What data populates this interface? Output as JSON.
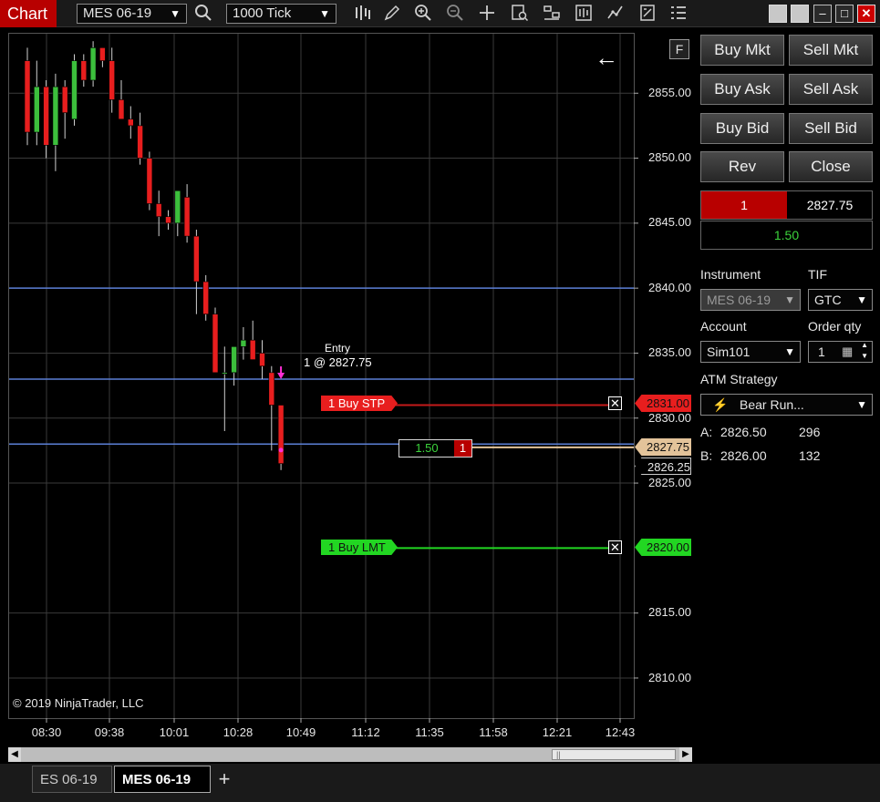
{
  "toolbar": {
    "title": "Chart",
    "instrument": "MES 06-19",
    "interval": "1000 Tick",
    "tools": [
      "bars-type-icon",
      "pencil-draw-icon",
      "zoom-in-icon",
      "zoom-out-icon",
      "crosshair-icon",
      "data-box-icon",
      "indicators-icon",
      "strategies-icon",
      "chart-trader-icon",
      "properties-icon",
      "menu-list-icon"
    ]
  },
  "chart": {
    "price_axis": [
      "2855.00",
      "2850.00",
      "2845.00",
      "2840.00",
      "2835.00",
      "2830.00",
      "2825.00",
      "2815.00",
      "2810.00"
    ],
    "time_axis": [
      "08:30",
      "09:38",
      "10:01",
      "10:28",
      "10:49",
      "11:12",
      "11:35",
      "11:58",
      "12:21",
      "12:43"
    ],
    "copyright": "© 2019 NinjaTrader, LLC",
    "f_button": "F",
    "entry_label": "Entry",
    "entry_detail": "1 @ 2827.75",
    "buy_stop_order": "1  Buy STP",
    "buy_stop_price": "2831.00",
    "buy_limit_order": "1  Buy LMT",
    "buy_limit_price": "2820.00",
    "position_price": "2827.75",
    "last_price": "2826.25",
    "position_pnl": "1.50",
    "position_qty": "1",
    "colors": {
      "up_candle": "#3cbf3c",
      "down_candle": "#e81e1e",
      "stop_line": "#c41a1a",
      "limit_line": "#22d622",
      "position_line": "#e3c39a",
      "level_line": "#5b7fd6"
    },
    "candles": [
      {
        "o": 2857.5,
        "h": 2858.5,
        "l": 2851.0,
        "c": 2852.0
      },
      {
        "o": 2852.0,
        "h": 2857.5,
        "l": 2851.0,
        "c": 2855.5
      },
      {
        "o": 2855.5,
        "h": 2856.0,
        "l": 2850.0,
        "c": 2851.0
      },
      {
        "o": 2851.0,
        "h": 2856.5,
        "l": 2849.0,
        "c": 2855.5
      },
      {
        "o": 2855.5,
        "h": 2856.0,
        "l": 2851.5,
        "c": 2853.5
      },
      {
        "o": 2853.0,
        "h": 2858.0,
        "l": 2852.5,
        "c": 2857.5
      },
      {
        "o": 2857.5,
        "h": 2858.0,
        "l": 2855.5,
        "c": 2856.0
      },
      {
        "o": 2856.0,
        "h": 2859.0,
        "l": 2855.5,
        "c": 2858.5
      },
      {
        "o": 2858.5,
        "h": 2858.5,
        "l": 2857.0,
        "c": 2857.5
      },
      {
        "o": 2857.5,
        "h": 2858.5,
        "l": 2853.5,
        "c": 2854.5
      },
      {
        "o": 2854.5,
        "h": 2856.0,
        "l": 2853.0,
        "c": 2853.0
      },
      {
        "o": 2853.0,
        "h": 2854.0,
        "l": 2851.5,
        "c": 2852.5
      },
      {
        "o": 2852.5,
        "h": 2853.5,
        "l": 2849.5,
        "c": 2850.0
      },
      {
        "o": 2850.0,
        "h": 2850.5,
        "l": 2846.0,
        "c": 2846.5
      },
      {
        "o": 2846.5,
        "h": 2847.5,
        "l": 2844.0,
        "c": 2845.5
      },
      {
        "o": 2845.5,
        "h": 2846.0,
        "l": 2844.5,
        "c": 2845.0
      },
      {
        "o": 2845.0,
        "h": 2847.5,
        "l": 2844.0,
        "c": 2847.5
      },
      {
        "o": 2847.0,
        "h": 2848.0,
        "l": 2843.5,
        "c": 2844.0
      },
      {
        "o": 2844.0,
        "h": 2844.5,
        "l": 2838.0,
        "c": 2840.5
      },
      {
        "o": 2840.5,
        "h": 2841.0,
        "l": 2837.5,
        "c": 2838.0
      },
      {
        "o": 2838.0,
        "h": 2838.5,
        "l": 2833.5,
        "c": 2833.5
      },
      {
        "o": 2833.5,
        "h": 2835.5,
        "l": 2829.0,
        "c": 2833.5
      },
      {
        "o": 2833.5,
        "h": 2835.5,
        "l": 2832.5,
        "c": 2835.5
      },
      {
        "o": 2835.5,
        "h": 2837.0,
        "l": 2834.5,
        "c": 2836.0
      },
      {
        "o": 2836.0,
        "h": 2837.5,
        "l": 2834.5,
        "c": 2834.5
      },
      {
        "o": 2835.0,
        "h": 2836.0,
        "l": 2833.0,
        "c": 2834.0
      },
      {
        "o": 2833.5,
        "h": 2834.0,
        "l": 2827.5,
        "c": 2831.0
      },
      {
        "o": 2831.0,
        "h": 2831.0,
        "l": 2826.0,
        "c": 2826.5
      }
    ]
  },
  "scrollbar": {
    "thumb_grip": "||"
  },
  "tabs": {
    "items": [
      {
        "label": "ES 06-19"
      },
      {
        "label": "MES 06-19"
      }
    ],
    "add": "+"
  },
  "panel": {
    "buy_mkt": "Buy Mkt",
    "sell_mkt": "Sell Mkt",
    "buy_ask": "Buy Ask",
    "sell_ask": "Sell Ask",
    "buy_bid": "Buy Bid",
    "sell_bid": "Sell Bid",
    "rev": "Rev",
    "close": "Close",
    "position_qty": "1",
    "position_avg": "2827.75",
    "position_pnl": "1.50",
    "instrument_label": "Instrument",
    "instrument_value": "MES 06-19",
    "tif_label": "TIF",
    "tif_value": "GTC",
    "account_label": "Account",
    "account_value": "Sim101",
    "order_qty_label": "Order qty",
    "order_qty_value": "1",
    "atm_label": "ATM Strategy",
    "atm_value": "Bear Run...",
    "ask_label": "A:",
    "ask_price": "2826.50",
    "ask_size": "296",
    "bid_label": "B:",
    "bid_price": "2826.00",
    "bid_size": "132"
  }
}
